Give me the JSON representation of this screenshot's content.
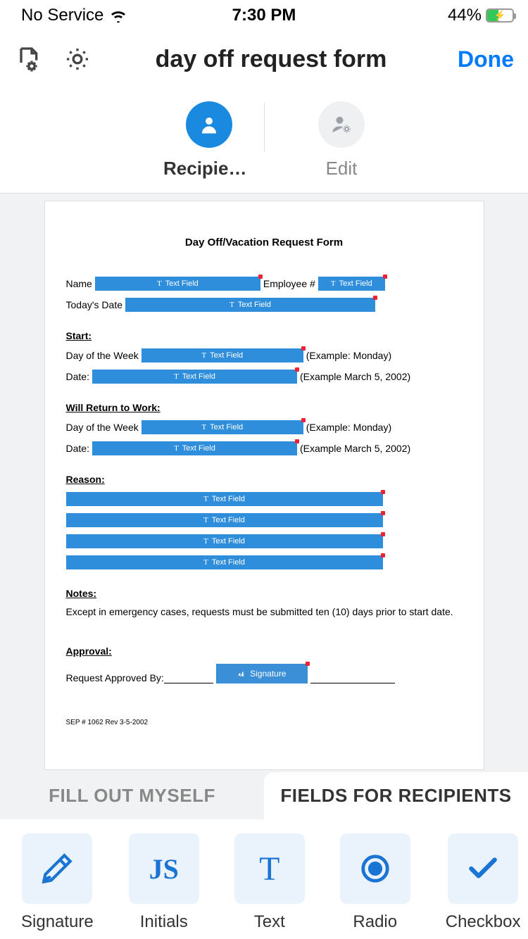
{
  "status_bar": {
    "service": "No Service",
    "time": "7:30 PM",
    "battery_pct": "44%"
  },
  "nav": {
    "title": "day off request form",
    "done": "Done"
  },
  "mode_tabs": {
    "recipient": "Recipien...",
    "edit": "Edit"
  },
  "document": {
    "title": "Day Off/Vacation Request Form",
    "labels": {
      "name": "Name",
      "employee_no": "Employee #",
      "todays_date": "Today's Date",
      "start": "Start:",
      "day_of_week": "Day of the Week",
      "example_monday": "(Example: Monday)",
      "date": "Date:",
      "example_date": "(Example March 5, 2002)",
      "will_return": "Will Return to Work:",
      "reason": "Reason:",
      "notes": "Notes:",
      "notes_text": "Except in emergency cases, requests must be submitted ten (10) days prior to start date.",
      "approval": "Approval:",
      "approved_by": "Request Approved By:",
      "footer": "SEP # 1062 Rev 3-5-2002"
    },
    "field_badge": "Text Field",
    "signature_badge": "Signature"
  },
  "bottom_tabs": {
    "fill_myself": "FILL OUT MYSELF",
    "fields_recipients": "FIELDS FOR RECIPIENTS"
  },
  "palette": {
    "signature": "Signature",
    "initials": "Initials",
    "text": "Text",
    "radio": "Radio",
    "checkbox": "Checkbox"
  }
}
